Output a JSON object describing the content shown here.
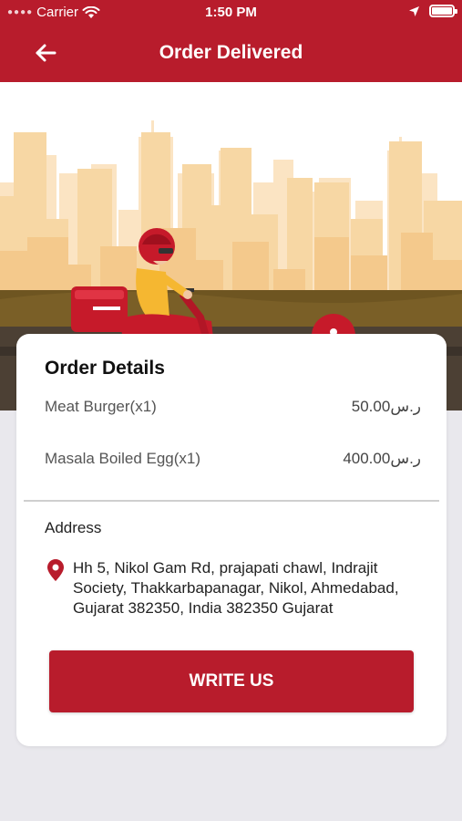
{
  "status_bar": {
    "carrier": "Carrier",
    "time": "1:50 PM",
    "icons": [
      "signal-dots-icon",
      "wifi-icon",
      "location-arrow-icon",
      "battery-icon"
    ]
  },
  "nav": {
    "title": "Order Delivered",
    "back_icon": "arrow-left-icon"
  },
  "colors": {
    "primary": "#B81C2C",
    "background": "#E9E8ED",
    "card": "#FFFFFF"
  },
  "order_details": {
    "title": "Order Details",
    "items": [
      {
        "name": "Meat Burger(x1)",
        "price": "50.00ر.س"
      },
      {
        "name": "Masala Boiled Egg(x1)",
        "price": "400.00ر.س"
      }
    ]
  },
  "address": {
    "label": "Address",
    "icon": "map-pin-icon",
    "text": "Hh 5, Nikol Gam Rd, prajapati chawl, Indrajit Society, Thakkarbapanagar, Nikol, Ahmedabad, Gujarat 382350, India 382350 Gujarat"
  },
  "actions": {
    "write_us_label": "WRITE US"
  }
}
